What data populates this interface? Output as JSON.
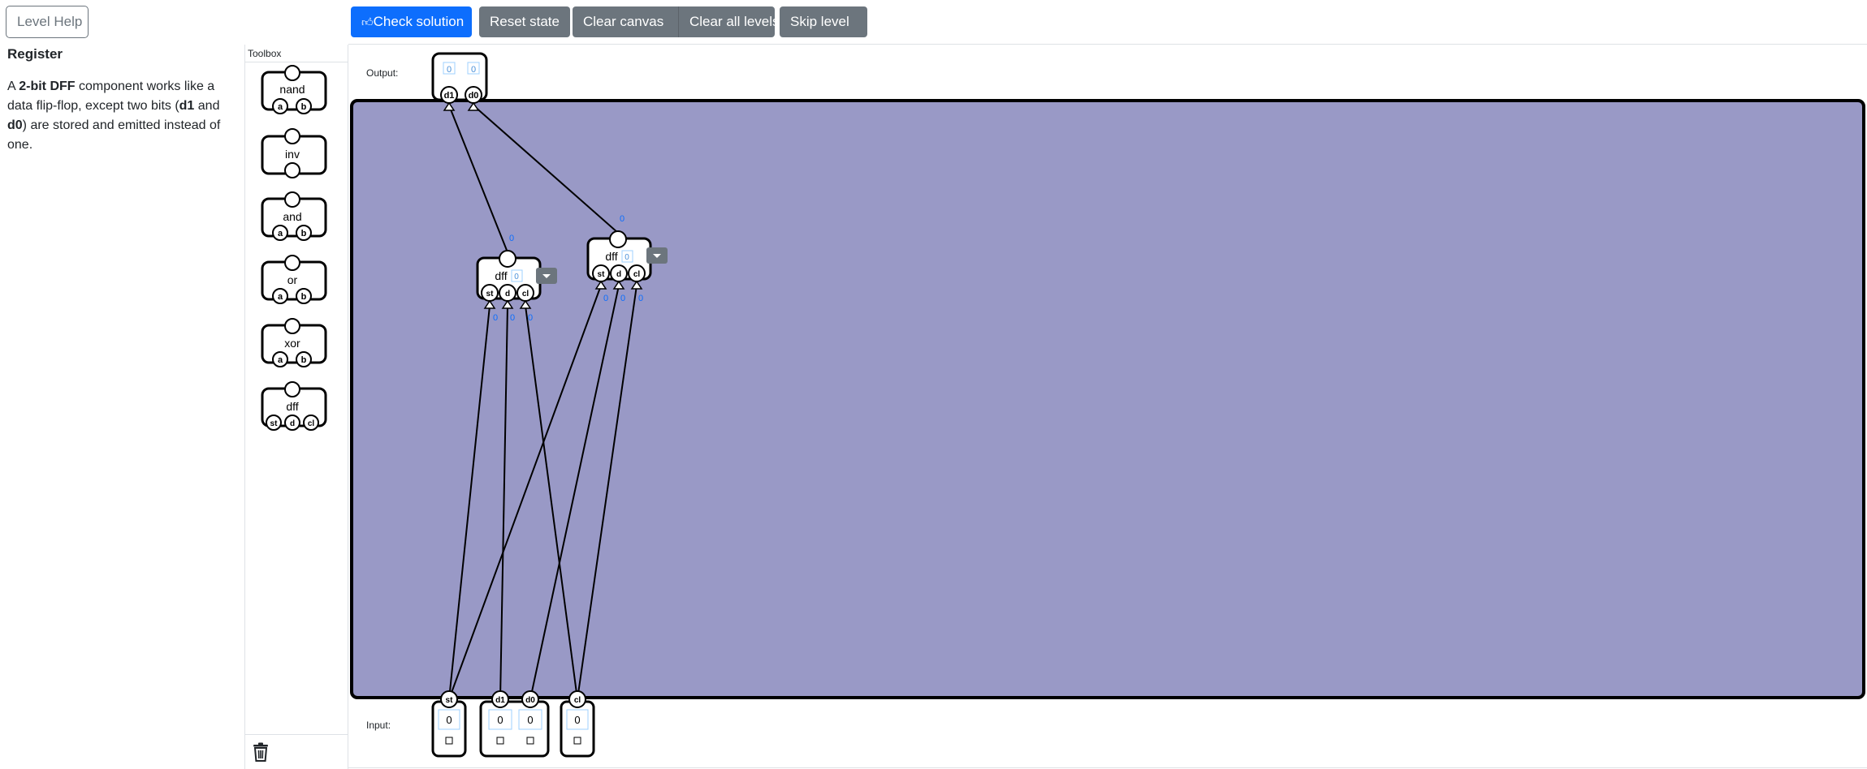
{
  "toolbar": {
    "help_label": "Level Help",
    "check_label": "Check solution",
    "reset_label": "Reset state",
    "clear_canvas_label": "Clear canvas",
    "clear_levels_label": "Clear all levels",
    "skip_label": "Skip level"
  },
  "level": {
    "title": "Register",
    "desc_1": "A ",
    "desc_bold_1": "2-bit DFF",
    "desc_2": " component works like a data flip-flop, except two bits (",
    "desc_bold_2": "d1",
    "desc_3": " and ",
    "desc_bold_3": "d0",
    "desc_4": ") are stored and emitted instead of one."
  },
  "toolbox": {
    "header": "Toolbox",
    "items": [
      {
        "name": "nand",
        "pins": [
          "a",
          "b"
        ]
      },
      {
        "name": "inv",
        "pins": []
      },
      {
        "name": "and",
        "pins": [
          "a",
          "b"
        ]
      },
      {
        "name": "or",
        "pins": [
          "a",
          "b"
        ]
      },
      {
        "name": "xor",
        "pins": [
          "a",
          "b"
        ]
      },
      {
        "name": "dff",
        "pins": [
          "st",
          "d",
          "cl"
        ]
      }
    ]
  },
  "output_block": {
    "label": "Output:",
    "pins": [
      "d1",
      "d0"
    ],
    "values": [
      "0",
      "0"
    ]
  },
  "input_block": {
    "label": "Input:",
    "groups": [
      {
        "pins": [
          "st"
        ],
        "values": [
          "0"
        ]
      },
      {
        "pins": [
          "d1",
          "d0"
        ],
        "values": [
          "0",
          "0"
        ]
      },
      {
        "pins": [
          "cl"
        ],
        "values": [
          "0"
        ]
      }
    ]
  },
  "components": [
    {
      "name": "dff",
      "pins": [
        "st",
        "d",
        "cl"
      ],
      "state": "0",
      "out_value": "0",
      "in_values": [
        "0",
        "0",
        "0"
      ]
    },
    {
      "name": "dff",
      "pins": [
        "st",
        "d",
        "cl"
      ],
      "state": "0",
      "out_value": "0",
      "in_values": [
        "0",
        "0",
        "0"
      ]
    }
  ],
  "colors": {
    "primary": "#0d6efd",
    "secondary": "#6c757d",
    "canvas": "#9999c6",
    "value_badge": "#b3d9ff"
  },
  "icons": {
    "check": "thumbs-up-icon",
    "trash": "trash-icon",
    "dropdown": "caret-down-icon"
  }
}
